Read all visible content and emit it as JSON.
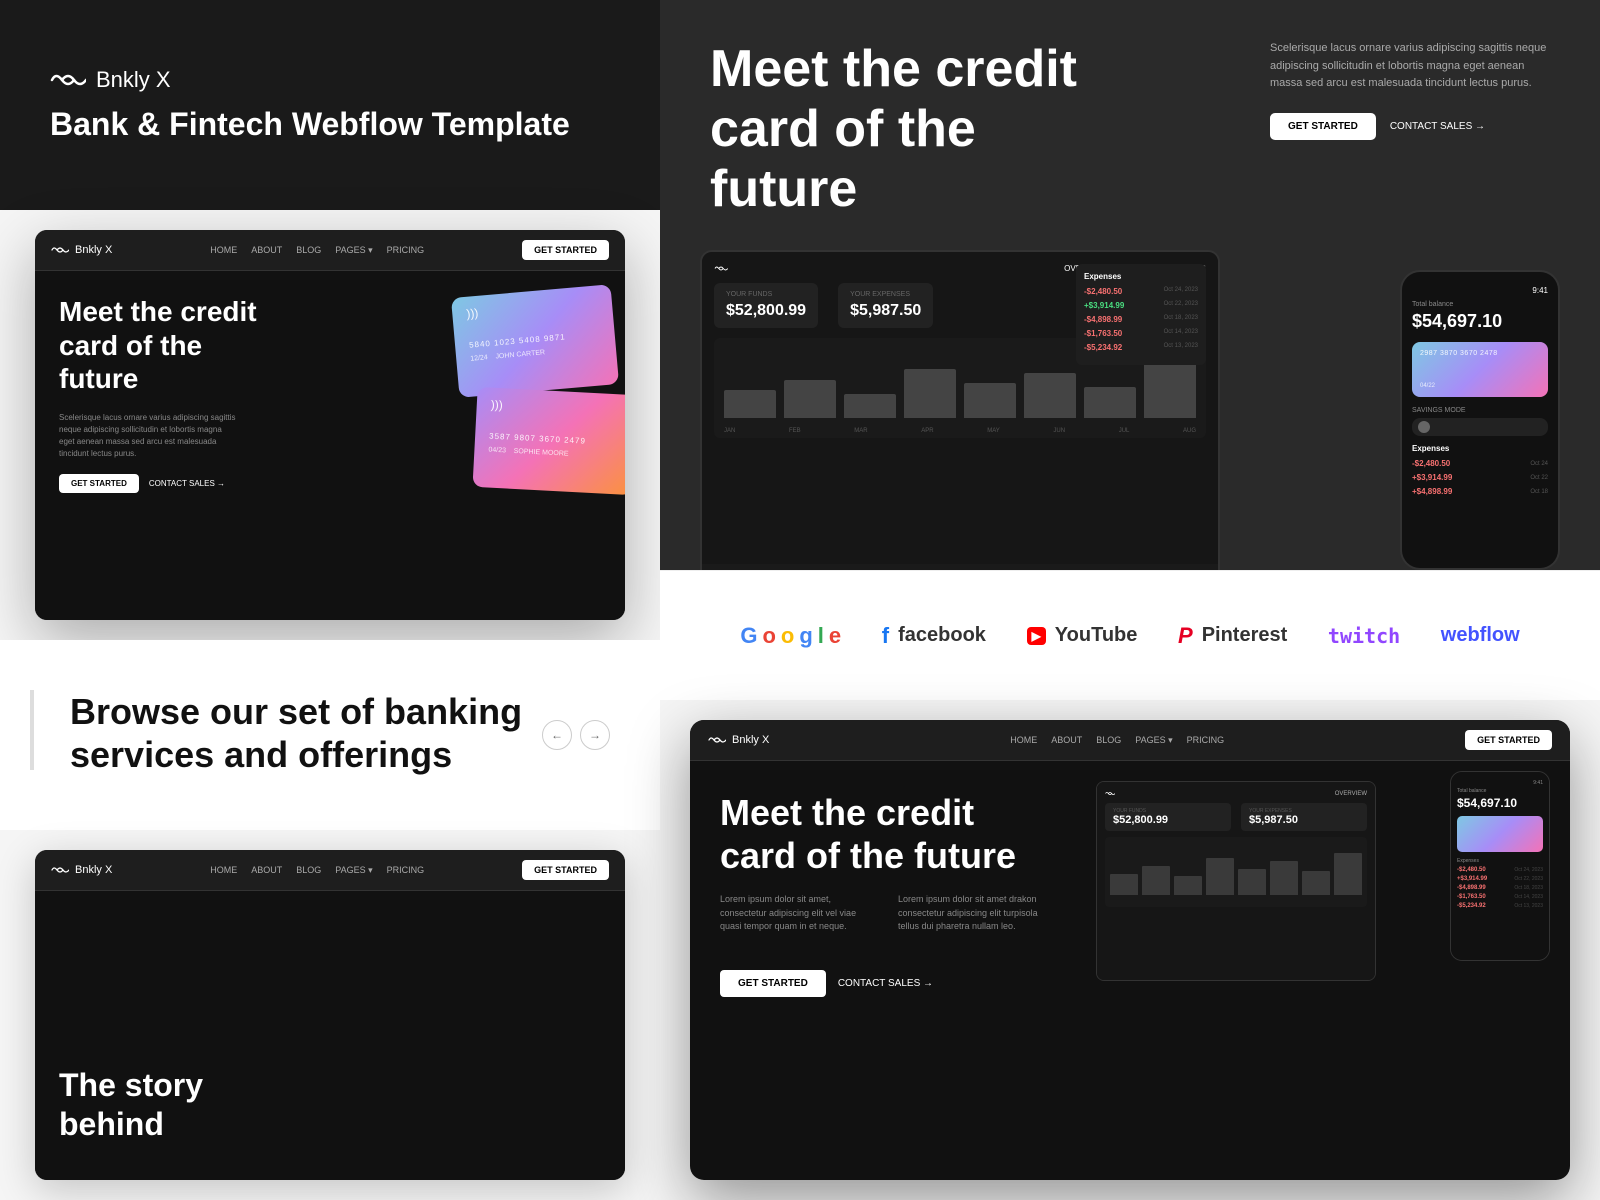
{
  "app": {
    "name": "Bnkly X",
    "tagline": "Bank & Fintech Webflow Template"
  },
  "top_left": {
    "logo_text": "Bnkly X",
    "tagline": "Bank & Fintech Webflow Template"
  },
  "hero": {
    "headline": "Meet the credit card of the future",
    "big_headline": "Meet the credit card of the future",
    "description": "Scelerisque lacus ornare varius adipiscing sagittis neque adipiscing sollicitudin et lobortis magna eget aenean massa sed arcu est malesuada tincidunt lectus purus.",
    "cta_primary": "GET STARTED",
    "cta_secondary": "CONTACT SALES →"
  },
  "nav": {
    "logo": "Bnkly X",
    "links": [
      "HOME",
      "ABOUT",
      "BLOG",
      "PAGES ▾",
      "PRICING"
    ],
    "cta": "GET STARTED"
  },
  "stats": {
    "funds_label": "YOUR FUNDS",
    "funds_value": "$52,800.99",
    "expenses_label": "YOUR EXPENSES",
    "expenses_value": "$5,987.50",
    "balance_label": "Total balance",
    "balance_value": "$54,697.10"
  },
  "expenses": [
    {
      "amount": "-$2,480.50",
      "date": "Oct 24, 2023",
      "type": "neg"
    },
    {
      "amount": "+$3,914.99",
      "date": "Oct 22, 2023",
      "type": "pos"
    },
    {
      "amount": "-$4,898.99",
      "date": "Oct 18, 2023",
      "type": "neg"
    },
    {
      "amount": "-$1,763.50",
      "date": "Oct 14, 2023",
      "type": "neg"
    },
    {
      "amount": "-$5,234.92",
      "date": "Oct 13, 2023",
      "type": "neg"
    }
  ],
  "phone_expenses": [
    {
      "amount": "-$2,480.50",
      "date": "Oct 24, 2023",
      "type": "neg"
    },
    {
      "amount": "+$3,914.99",
      "date": "Oct 22, 2023",
      "type": "pos"
    },
    {
      "amount": "+$4,898.99",
      "date": "Oct 18, 2023",
      "type": "pos"
    }
  ],
  "cards": [
    {
      "number": "5840 1023 5408 9871",
      "date": "12/24",
      "name": "JOHN CARTER"
    },
    {
      "number": "3587 9807 3670 2479",
      "date": "04/23",
      "name": "SOPHIE MOORE"
    }
  ],
  "chart_labels": [
    "JAN",
    "FEB",
    "MAR",
    "APR",
    "MAY",
    "JUN",
    "JUL",
    "AUG"
  ],
  "chart_bars": [
    40,
    55,
    35,
    70,
    50,
    65,
    45,
    80
  ],
  "brands": [
    "Google",
    "facebook",
    "YouTube",
    "Pinterest",
    "twitch",
    "webflow"
  ],
  "services_heading": "Browse our set of banking services and offerings",
  "story_headline": "The story behind",
  "bottom_hero": {
    "headline": "Meet the credit card of the future",
    "desc_1": "Lorem ipsum dolor sit amet, consectetur adipiscing elit vel viae quasi tempor quam in et neque.",
    "desc_2": "Lorem ipsum dolor sit amet drakon consectetur adipiscing elit turpisola tellus dui pharetra nullam leo.",
    "cta": "GET STARTED",
    "contact": "CONTACT SALES →"
  }
}
